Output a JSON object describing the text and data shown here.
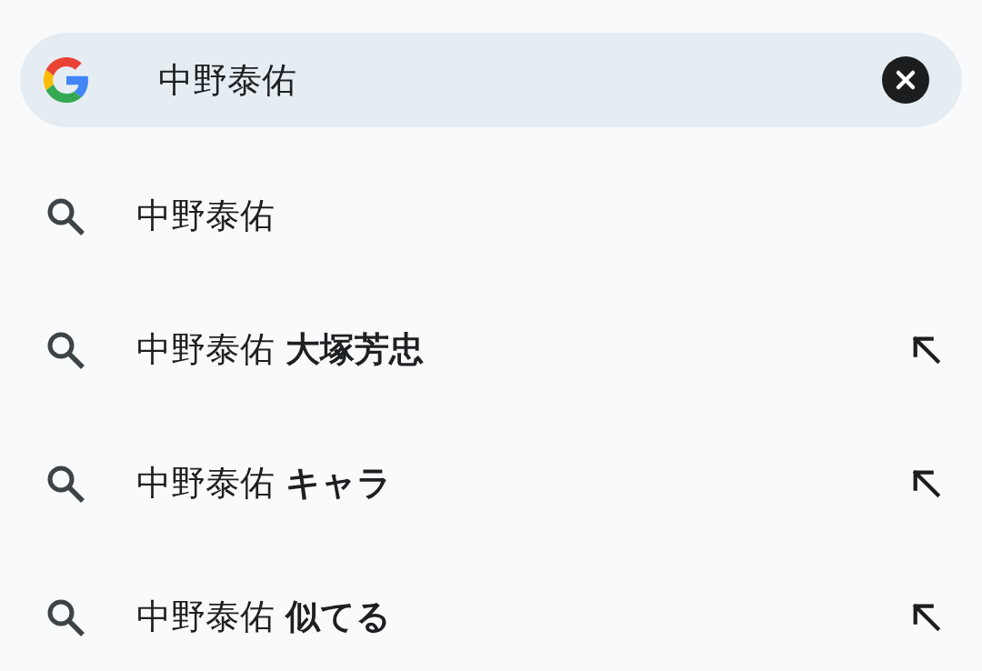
{
  "search": {
    "value": "中野泰佑"
  },
  "suggestions": [
    {
      "text": "中野泰佑",
      "fill_arrow": false
    },
    {
      "text": "中野泰佑 **大塚芳忠**",
      "fill_arrow": true
    },
    {
      "text": "中野泰佑 **キャラ**",
      "fill_arrow": true
    },
    {
      "text": "中野泰佑 **似てる**",
      "fill_arrow": true
    }
  ]
}
